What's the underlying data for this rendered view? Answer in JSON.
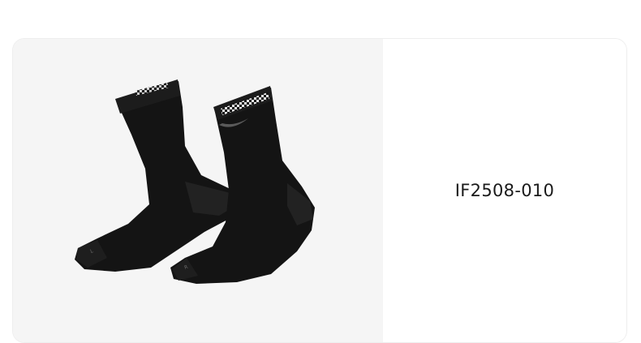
{
  "product": {
    "code": "IF2508-010",
    "image": {
      "subject": "pair-of-black-crew-socks",
      "colors": {
        "sock": "#141414",
        "sock_shade": "#222222",
        "swoosh": "#5a5a5a",
        "checker_light": "#e8e8e8",
        "background": "#f5f5f5"
      }
    }
  }
}
